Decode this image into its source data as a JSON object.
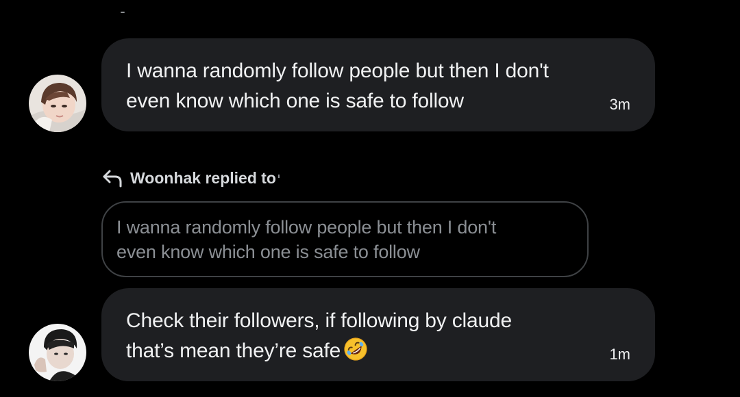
{
  "messages": [
    {
      "line1": "I wanna randomly follow people but then I don't",
      "line2": "even know which one is safe to follow",
      "time": "3m"
    },
    {
      "line1": "Check their followers, if following by claude",
      "line2": "that’s mean they’re safe",
      "emoji": "rolling-on-the-floor-laughing",
      "time": "1m"
    }
  ],
  "reply": {
    "label": "Woonhak replied to",
    "icon": "reply-arrow-icon"
  },
  "quoted": {
    "line1": "I wanna randomly follow people but then I don't",
    "line2": "even know which one is safe to follow"
  },
  "colors": {
    "background": "#000000",
    "bubble": "#1e1f22",
    "quoted_border": "#3f4245",
    "quoted_text": "#8b8f94"
  }
}
